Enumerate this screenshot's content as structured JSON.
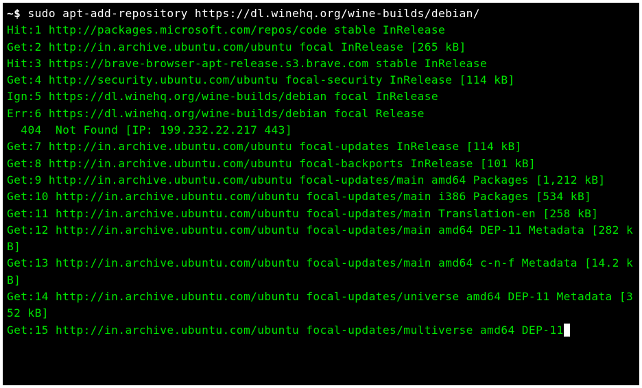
{
  "prompt": {
    "indent": "                      ",
    "symbol": "~$ ",
    "command": "sudo apt-add-repository https://dl.winehq.org/wine-builds/debian/"
  },
  "lines": [
    "Hit:1 http://packages.microsoft.com/repos/code stable InRelease",
    "Get:2 http://in.archive.ubuntu.com/ubuntu focal InRelease [265 kB]",
    "Hit:3 https://brave-browser-apt-release.s3.brave.com stable InRelease",
    "Get:4 http://security.ubuntu.com/ubuntu focal-security InRelease [114 kB]",
    "Ign:5 https://dl.winehq.org/wine-builds/debian focal InRelease",
    "Err:6 https://dl.winehq.org/wine-builds/debian focal Release",
    "  404  Not Found [IP: 199.232.22.217 443]",
    "Get:7 http://in.archive.ubuntu.com/ubuntu focal-updates InRelease [114 kB]",
    "Get:8 http://in.archive.ubuntu.com/ubuntu focal-backports InRelease [101 kB]",
    "Get:9 http://in.archive.ubuntu.com/ubuntu focal-updates/main amd64 Packages [1,212 kB]",
    "Get:10 http://in.archive.ubuntu.com/ubuntu focal-updates/main i386 Packages [534 kB]",
    "Get:11 http://in.archive.ubuntu.com/ubuntu focal-updates/main Translation-en [258 kB]",
    "Get:12 http://in.archive.ubuntu.com/ubuntu focal-updates/main amd64 DEP-11 Metadata [282 kB]",
    "Get:13 http://in.archive.ubuntu.com/ubuntu focal-updates/main amd64 c-n-f Metadata [14.2 kB]",
    "Get:14 http://in.archive.ubuntu.com/ubuntu focal-updates/universe amd64 DEP-11 Metadata [352 kB]",
    "Get:15 http://in.archive.ubuntu.com/ubuntu focal-updates/multiverse amd64 DEP-11"
  ]
}
